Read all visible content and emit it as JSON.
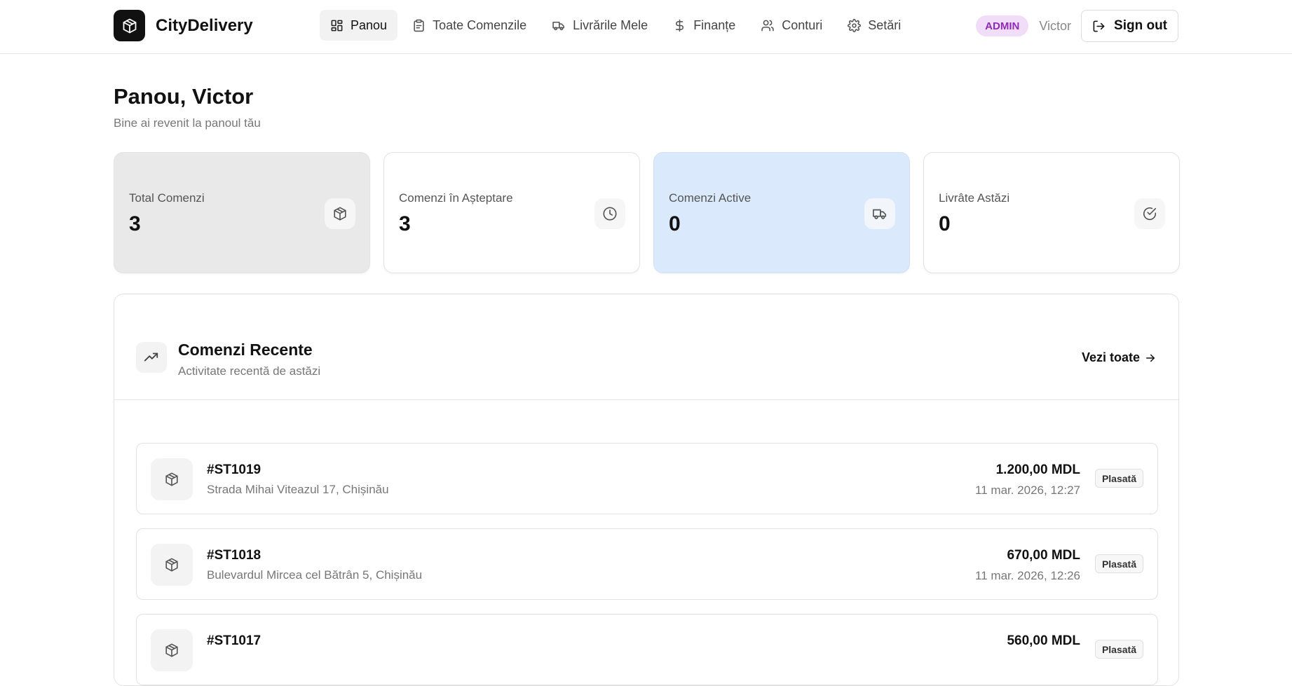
{
  "app": {
    "name": "CityDelivery",
    "logo_icon": "box-icon"
  },
  "nav": {
    "items": [
      {
        "label": "Panou",
        "icon": "dashboard-grid-icon",
        "active": true
      },
      {
        "label": "Toate Comenzile",
        "icon": "clipboard-icon",
        "active": false
      },
      {
        "label": "Livrările Mele",
        "icon": "truck-icon",
        "active": false
      },
      {
        "label": "Finanțe",
        "icon": "dollar-icon",
        "active": false
      },
      {
        "label": "Conturi",
        "icon": "users-icon",
        "active": false
      },
      {
        "label": "Setări",
        "icon": "gear-icon",
        "active": false
      }
    ]
  },
  "user": {
    "role": "ADMIN",
    "name": "Victor",
    "signout_label": "Sign out"
  },
  "page": {
    "title": "Panou, Victor",
    "subtitle": "Bine ai revenit la panoul tău"
  },
  "stats": [
    {
      "label": "Total Comenzi",
      "value": "3",
      "icon": "box-icon"
    },
    {
      "label": "Comenzi în Așteptare",
      "value": "3",
      "icon": "clock-icon"
    },
    {
      "label": "Comenzi Active",
      "value": "0",
      "icon": "truck-icon"
    },
    {
      "label": "Livrâte Astăzi",
      "value": "0",
      "icon": "check-circle-icon"
    }
  ],
  "recent": {
    "title": "Comenzi Recente",
    "subtitle": "Activitate recentă de astăzi",
    "see_all": "Vezi toate",
    "orders": [
      {
        "id": "#ST1019",
        "address": "Strada Mihai Viteazul 17, Chișinău",
        "amount": "1.200,00 MDL",
        "date": "11 mar. 2026, 12:27",
        "status": "Plasată"
      },
      {
        "id": "#ST1018",
        "address": "Bulevardul Mircea cel Bătrân 5, Chișinău",
        "amount": "670,00 MDL",
        "date": "11 mar. 2026, 12:26",
        "status": "Plasată"
      },
      {
        "id": "#ST1017",
        "address": "",
        "amount": "560,00 MDL",
        "date": "",
        "status": "Plasată"
      }
    ]
  },
  "colors": {
    "brand": "#111111",
    "admin_badge_bg": "#f1ddf7",
    "admin_badge_text": "#8e2bb5",
    "active_card_bg": "#dbe9fc",
    "total_card_bg": "#e9e9e9"
  }
}
